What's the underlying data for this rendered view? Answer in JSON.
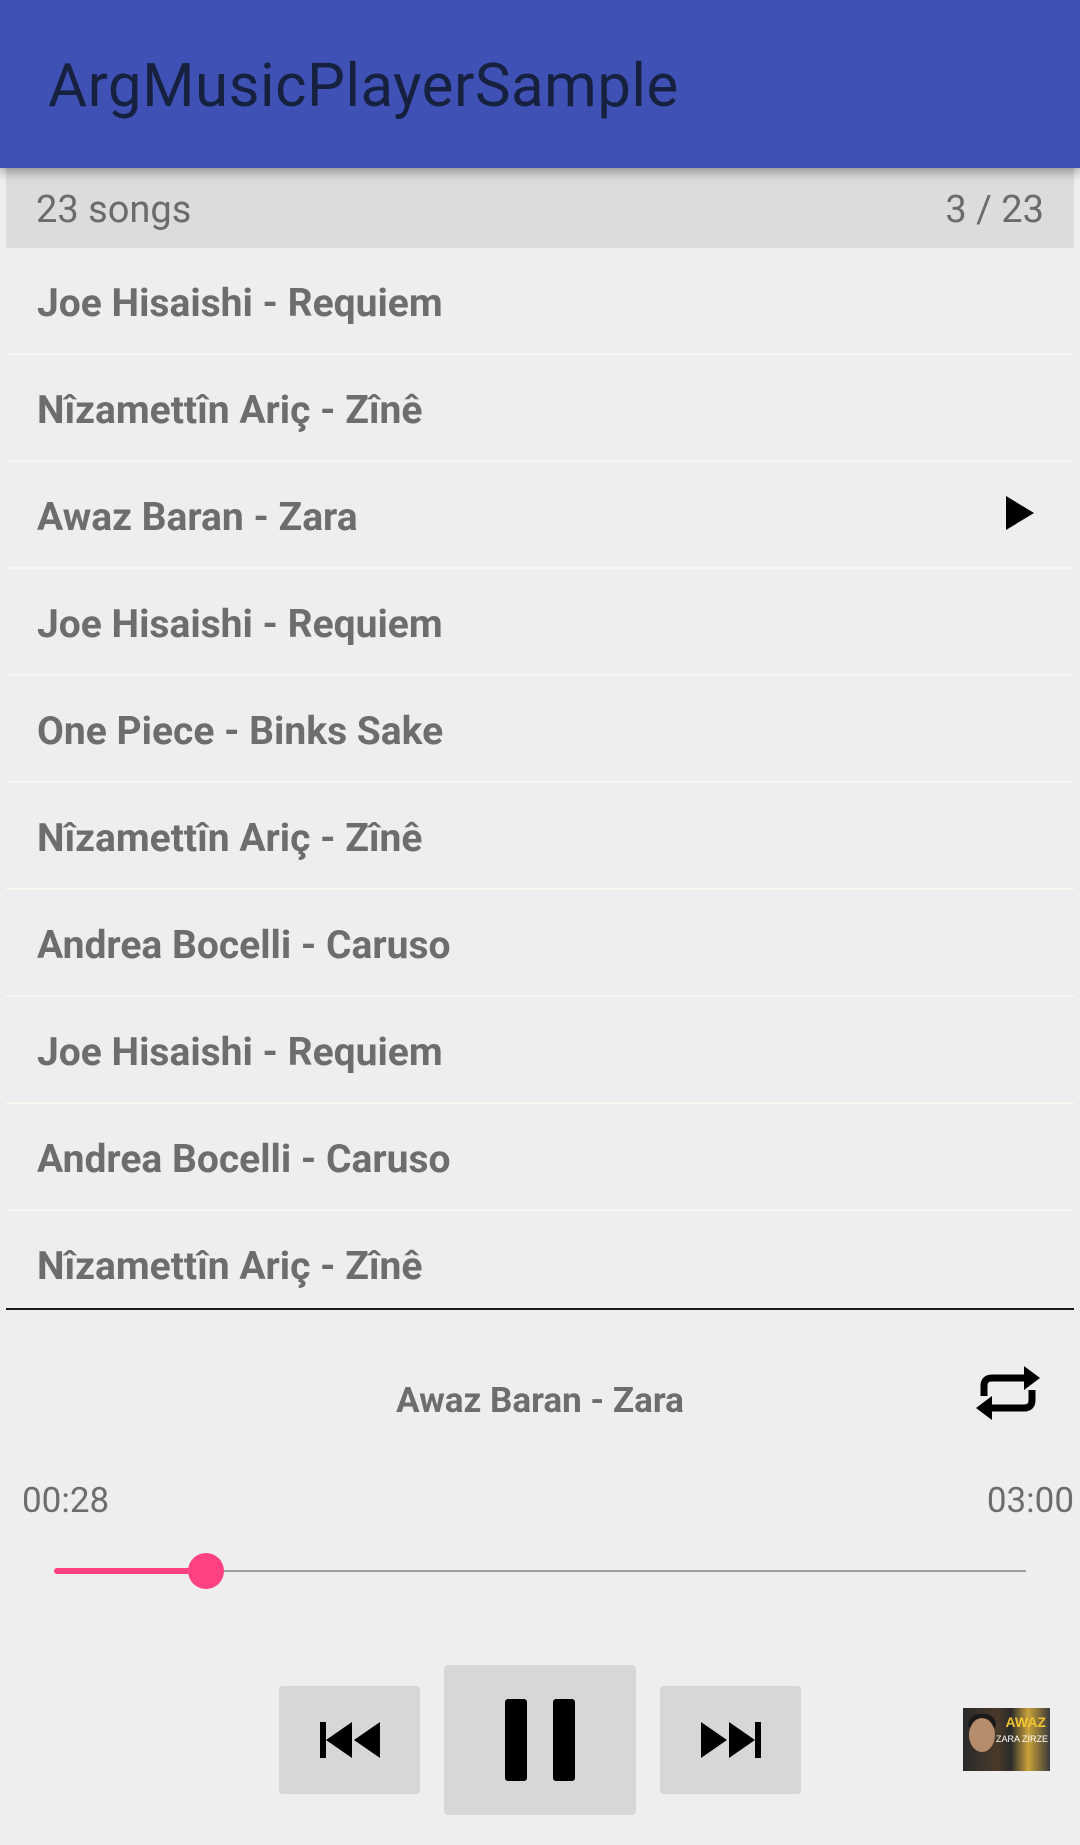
{
  "appbar": {
    "title": "ArgMusicPlayerSample"
  },
  "list_header": {
    "count": "23 songs",
    "position": "3 / 23"
  },
  "songs": [
    {
      "label": "Joe Hisaishi - Requiem",
      "playing": false
    },
    {
      "label": "Nîzamettîn Ariç - Zînê",
      "playing": false
    },
    {
      "label": "Awaz Baran - Zara",
      "playing": true
    },
    {
      "label": "Joe Hisaishi - Requiem",
      "playing": false
    },
    {
      "label": "One Piece - Binks Sake",
      "playing": false
    },
    {
      "label": "Nîzamettîn Ariç - Zînê",
      "playing": false
    },
    {
      "label": "Andrea Bocelli - Caruso",
      "playing": false
    },
    {
      "label": "Joe Hisaishi - Requiem",
      "playing": false
    },
    {
      "label": "Andrea Bocelli - Caruso",
      "playing": false
    },
    {
      "label": "Nîzamettîn Ariç - Zînê",
      "playing": false
    }
  ],
  "player": {
    "now_playing": "Awaz Baran - Zara",
    "current_time": "00:28",
    "total_time": "03:00",
    "progress_fraction": 0.156,
    "accent_color": "#ff4081",
    "icons": {
      "repeat": "repeat-icon",
      "previous": "skip-previous-icon",
      "pause": "pause-icon",
      "next": "skip-next-icon",
      "playing_indicator": "play-icon"
    },
    "thumbnail_text": {
      "line1": "AWAZ",
      "line2": "ZARA ZİRZE"
    }
  },
  "colors": {
    "appbar": "#3f51b5",
    "accent": "#ff4081"
  }
}
